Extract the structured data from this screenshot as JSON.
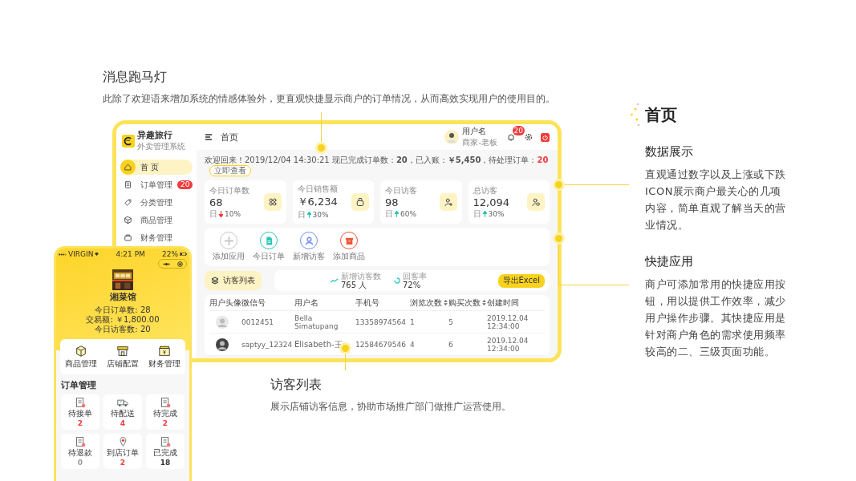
{
  "marquee_note": {
    "title": "消息跑马灯",
    "text": "此除了欢迎语来增加系统的情感体验外，更直观快捷显示商户的订单情况，从而高效实现用户的使用目的。"
  },
  "dashboard": {
    "brand": {
      "name": "异趣旅行",
      "subtitle": "外卖管理系统"
    },
    "sidebar": {
      "items": [
        {
          "label": "首 页",
          "selected": true,
          "kind": "home"
        },
        {
          "label": "订单管理",
          "selected": false,
          "kind": "order",
          "badge": "20"
        },
        {
          "label": "分类管理",
          "selected": false,
          "kind": "tag"
        },
        {
          "label": "商品管理",
          "selected": false,
          "kind": "cube"
        },
        {
          "label": "财务管理",
          "selected": false,
          "kind": "wallet"
        }
      ]
    },
    "header": {
      "title": "首页",
      "user_name": "用户名",
      "user_role": "商家-老板",
      "notifications": "20"
    },
    "welcome": {
      "text": "欢迎回来！2019/12/04 14:30:21 现已完成订单数：**20**，已入账：**￥5,450**，待处理订单：",
      "pending": "20",
      "button": "立即查看"
    },
    "stats": [
      {
        "label": "今日订单数",
        "value": "68",
        "period": "日",
        "rising": false,
        "change": "10%",
        "kind": "grid"
      },
      {
        "label": "今日销售额",
        "value": "￥6,234",
        "period": "日",
        "rising": true,
        "change": "30%",
        "kind": "money"
      },
      {
        "label": "今日访客",
        "value": "98",
        "period": "日",
        "rising": true,
        "change": "60%",
        "kind": "user-add"
      },
      {
        "label": "总访客",
        "value": "12,094",
        "period": "日",
        "rising": true,
        "change": "30%",
        "kind": "user-time"
      }
    ],
    "quick_apps": [
      {
        "label": "添加应用",
        "kind": "add",
        "color": "#c8c8c8"
      },
      {
        "label": "今日订单",
        "kind": "document",
        "color": "#2cc6b4"
      },
      {
        "label": "新增访客",
        "kind": "person",
        "color": "#6f8ff5"
      },
      {
        "label": "添加商品",
        "kind": "box",
        "color": "#f0563a"
      }
    ],
    "visitor_bar": {
      "tab": "访客列表",
      "metrics": [
        {
          "label": "新增访客数",
          "value": "765 人",
          "kind": "line"
        },
        {
          "label": "回客率",
          "value": "72%",
          "kind": "ring"
        }
      ],
      "button": "导出Excel"
    },
    "table": {
      "columns": [
        {
          "label": "用户头像",
          "sortable": false
        },
        {
          "label": "微信号",
          "sortable": false
        },
        {
          "label": "用户名",
          "sortable": false
        },
        {
          "label": "手机号",
          "sortable": false
        },
        {
          "label": "浏览次数",
          "sortable": true
        },
        {
          "label": "购买次数",
          "sortable": true
        },
        {
          "label": "创建时间",
          "sortable": false
        }
      ],
      "rows": [
        {
          "cells": [
            "",
            "0012451",
            "Bella Simatupang",
            "13358974564",
            "1",
            "5",
            "2019.12.04 12:34:00"
          ]
        },
        {
          "cells": [
            "",
            "saptyy_12324",
            "Elisabeth-王",
            "12584679546",
            "4",
            "6",
            "2019.12.04 12:34:00"
          ]
        }
      ]
    }
  },
  "phone": {
    "status": {
      "carrier": "VIRGIN",
      "time": "4:21 PM",
      "battery": "22%"
    },
    "store": {
      "name": "湘菜馆"
    },
    "stats": [
      "今日订单数: 28",
      "交易额: ￥1,800.00",
      "今日访客数: 20"
    ],
    "menu": [
      {
        "label": "商品管理",
        "kind": "box"
      },
      {
        "label": "店铺配置",
        "kind": "store"
      },
      {
        "label": "财务管理",
        "kind": "finance"
      }
    ],
    "orders_title": "订单管理",
    "orders": [
      {
        "label": "待接单",
        "count": "2",
        "kind": "doc",
        "color": "#f03c3c"
      },
      {
        "label": "待配送",
        "count": "4",
        "kind": "truck",
        "color": "#f03c3c"
      },
      {
        "label": "待完成",
        "count": "2",
        "kind": "doc",
        "color": "#f03c3c"
      },
      {
        "label": "待退款",
        "count": "0",
        "kind": "doc",
        "color": "#999999"
      },
      {
        "label": "到店订单",
        "count": "2",
        "kind": "pin",
        "color": "#f03c3c"
      },
      {
        "label": "已完成",
        "count": "18",
        "kind": "doc",
        "color": "#333333"
      }
    ]
  },
  "visitor_note": {
    "title": "访客列表",
    "text": "展示店铺访客信息，协助市场推广部门做推广运营使用。"
  },
  "side_panel": {
    "title": "首页",
    "sections": [
      {
        "title": "数据展示",
        "text": "直观通过数字以及上涨或下跌ICON展示商户最关心的几项内容，简单直观了解当天的营业情况。"
      },
      {
        "title": "快捷应用",
        "text": "商户可添加常用的快捷应用按钮，用以提供工作效率，减少用户操作步骤。其快捷应用是针对商户角色的需求使用频率较高的二、三级页面功能。"
      }
    ]
  }
}
